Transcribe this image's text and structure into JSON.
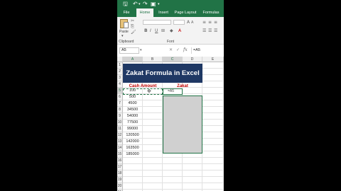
{
  "qat": {
    "save_icon": "save-icon",
    "undo_icon": "undo-icon",
    "redo_icon": "redo-icon",
    "layout_icon": "window-layout-icon"
  },
  "ribbon_tabs": [
    {
      "label": "File",
      "active": false
    },
    {
      "label": "Home",
      "active": true
    },
    {
      "label": "Insert",
      "active": false
    },
    {
      "label": "Page Layout",
      "active": false
    },
    {
      "label": "Formulas",
      "active": false
    }
  ],
  "ribbon": {
    "paste_label": "Paste",
    "clipboard_label": "Clipboard",
    "font_label": "Font",
    "bold": "B",
    "italic": "I",
    "underline": "U"
  },
  "formula_bar": {
    "name_box": "A5",
    "cancel_icon": "✕",
    "enter_icon": "✓",
    "fx_label": "fx",
    "formula": "=A5"
  },
  "columns": [
    {
      "label": "A",
      "selected": true
    },
    {
      "label": "B",
      "selected": false
    },
    {
      "label": "C",
      "selected": true
    },
    {
      "label": "D",
      "selected": false
    },
    {
      "label": "E",
      "selected": false
    }
  ],
  "rows": [
    "1",
    "2",
    "3",
    "4",
    "5",
    "6",
    "7",
    "8",
    "9",
    "10",
    "11",
    "12",
    "13",
    "14",
    "15",
    "16",
    "17",
    "18",
    "19",
    "20",
    "21"
  ],
  "sheet": {
    "title": "Zakat Formula in Excel",
    "header_cash": "Cash Amount",
    "header_zakat": "Zakat",
    "active_cell_value": "=A5",
    "cash_values": [
      "100",
      "500",
      "4500",
      "34500",
      "54000",
      "77500",
      "99000",
      "120500",
      "142000",
      "163500",
      "185000"
    ]
  },
  "colors": {
    "excel_green": "#217346",
    "title_fill": "#1f3864",
    "header_text": "#c00000"
  }
}
